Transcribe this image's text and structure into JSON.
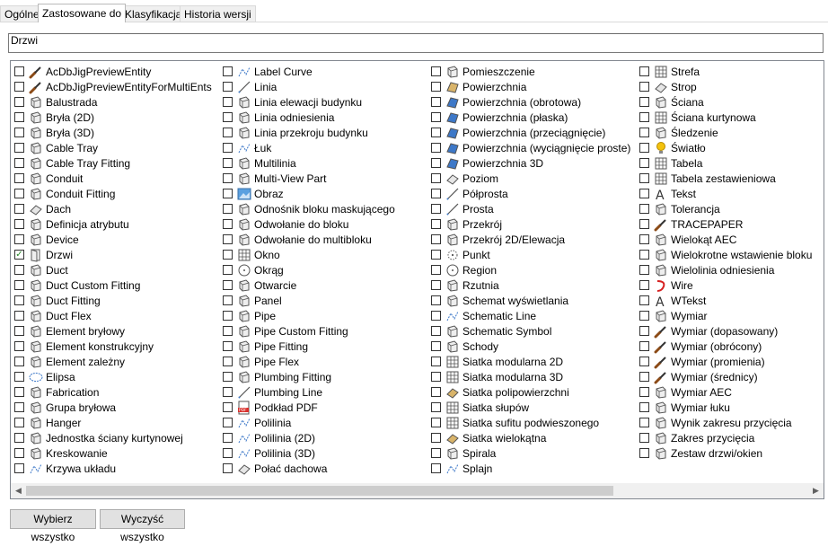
{
  "tabs": [
    "Ogólne",
    "Zastosowane do",
    "Klasyfikacja",
    "Historia wersji"
  ],
  "active_tab": 1,
  "search": {
    "value": "Drzwi"
  },
  "buttons": {
    "select_all": "Wybierz wszystko",
    "clear_all": "Wyczyść wszystko"
  },
  "columns": [
    [
      {
        "label": "AcDbJigPreviewEntity",
        "icon": "brush-icon",
        "checked": false
      },
      {
        "label": "AcDbJigPreviewEntityForMultiEnts",
        "icon": "brush-icon",
        "checked": false
      },
      {
        "label": "Balustrada",
        "icon": "railing-icon",
        "checked": false
      },
      {
        "label": "Bryła (2D)",
        "icon": "mass-2d-icon",
        "checked": false
      },
      {
        "label": "Bryła (3D)",
        "icon": "mass-3d-icon",
        "checked": false
      },
      {
        "label": "Cable Tray",
        "icon": "cable-tray-icon",
        "checked": false
      },
      {
        "label": "Cable Tray Fitting",
        "icon": "cable-tray-fitting-icon",
        "checked": false
      },
      {
        "label": "Conduit",
        "icon": "conduit-icon",
        "checked": false
      },
      {
        "label": "Conduit Fitting",
        "icon": "conduit-fitting-icon",
        "checked": false
      },
      {
        "label": "Dach",
        "icon": "roof-icon",
        "checked": false
      },
      {
        "label": "Definicja atrybutu",
        "icon": "tag-icon",
        "checked": false
      },
      {
        "label": "Device",
        "icon": "device-icon",
        "checked": false
      },
      {
        "label": "Drzwi",
        "icon": "door-icon",
        "checked": true
      },
      {
        "label": "Duct",
        "icon": "duct-icon",
        "checked": false
      },
      {
        "label": "Duct Custom Fitting",
        "icon": "duct-custom-fitting-icon",
        "checked": false
      },
      {
        "label": "Duct Fitting",
        "icon": "duct-fitting-icon",
        "checked": false
      },
      {
        "label": "Duct Flex",
        "icon": "duct-flex-icon",
        "checked": false
      },
      {
        "label": "Element bryłowy",
        "icon": "mass-element-icon",
        "checked": false
      },
      {
        "label": "Element konstrukcyjny",
        "icon": "structural-member-icon",
        "checked": false
      },
      {
        "label": "Element zależny",
        "icon": "dependent-element-icon",
        "checked": false
      },
      {
        "label": "Elipsa",
        "icon": "ellipse-icon",
        "checked": false
      },
      {
        "label": "Fabrication",
        "icon": "fabrication-icon",
        "checked": false
      },
      {
        "label": "Grupa bryłowa",
        "icon": "mass-group-icon",
        "checked": false
      },
      {
        "label": "Hanger",
        "icon": "hanger-icon",
        "checked": false
      },
      {
        "label": "Jednostka ściany kurtynowej",
        "icon": "curtain-wall-unit-icon",
        "checked": false
      },
      {
        "label": "Kreskowanie",
        "icon": "hatch-icon",
        "checked": false
      },
      {
        "label": "Krzywa układu",
        "icon": "layout-curve-icon",
        "checked": false
      }
    ],
    [
      {
        "label": "Label Curve",
        "icon": "label-curve-icon",
        "checked": false
      },
      {
        "label": "Linia",
        "icon": "line-icon",
        "checked": false
      },
      {
        "label": "Linia elewacji budynku",
        "icon": "elevation-line-icon",
        "checked": false
      },
      {
        "label": "Linia odniesienia",
        "icon": "reference-line-icon",
        "checked": false
      },
      {
        "label": "Linia przekroju budynku",
        "icon": "section-line-icon",
        "checked": false
      },
      {
        "label": "Łuk",
        "icon": "arc-icon",
        "checked": false
      },
      {
        "label": "Multilinia",
        "icon": "multiline-icon",
        "checked": false
      },
      {
        "label": "Multi-View Part",
        "icon": "multi-view-part-icon",
        "checked": false
      },
      {
        "label": "Obraz",
        "icon": "image-icon",
        "checked": false
      },
      {
        "label": "Odnośnik bloku maskującego",
        "icon": "mask-block-icon",
        "checked": false
      },
      {
        "label": "Odwołanie do bloku",
        "icon": "block-reference-icon",
        "checked": false
      },
      {
        "label": "Odwołanie do multibloku",
        "icon": "multiblock-reference-icon",
        "checked": false
      },
      {
        "label": "Okno",
        "icon": "window-icon",
        "checked": false
      },
      {
        "label": "Okrąg",
        "icon": "circle-icon",
        "checked": false
      },
      {
        "label": "Otwarcie",
        "icon": "opening-icon",
        "checked": false
      },
      {
        "label": "Panel",
        "icon": "panel-icon",
        "checked": false
      },
      {
        "label": "Pipe",
        "icon": "pipe-icon",
        "checked": false
      },
      {
        "label": "Pipe Custom Fitting",
        "icon": "pipe-custom-fitting-icon",
        "checked": false
      },
      {
        "label": "Pipe Fitting",
        "icon": "pipe-fitting-icon",
        "checked": false
      },
      {
        "label": "Pipe Flex",
        "icon": "pipe-flex-icon",
        "checked": false
      },
      {
        "label": "Plumbing Fitting",
        "icon": "plumbing-fitting-icon",
        "checked": false
      },
      {
        "label": "Plumbing Line",
        "icon": "plumbing-line-icon",
        "checked": false
      },
      {
        "label": "Podkład PDF",
        "icon": "pdf-icon",
        "checked": false
      },
      {
        "label": "Polilinia",
        "icon": "polyline-icon",
        "checked": false
      },
      {
        "label": "Polilinia (2D)",
        "icon": "polyline-2d-icon",
        "checked": false
      },
      {
        "label": "Polilinia (3D)",
        "icon": "polyline-3d-icon",
        "checked": false
      },
      {
        "label": "Połać dachowa",
        "icon": "roof-slab-icon",
        "checked": false
      }
    ],
    [
      {
        "label": "Pomieszczenie",
        "icon": "space-icon",
        "checked": false
      },
      {
        "label": "Powierzchnia",
        "icon": "surface-icon",
        "checked": false
      },
      {
        "label": "Powierzchnia (obrotowa)",
        "icon": "surface-revolve-icon",
        "checked": false
      },
      {
        "label": "Powierzchnia (płaska)",
        "icon": "surface-planar-icon",
        "checked": false
      },
      {
        "label": "Powierzchnia (przeciągnięcie)",
        "icon": "surface-sweep-icon",
        "checked": false
      },
      {
        "label": "Powierzchnia (wyciągnięcie proste)",
        "icon": "surface-extrude-icon",
        "checked": false
      },
      {
        "label": "Powierzchnia 3D",
        "icon": "surface-3d-icon",
        "checked": false
      },
      {
        "label": "Poziom",
        "icon": "level-icon",
        "checked": false
      },
      {
        "label": "Półprosta",
        "icon": "ray-icon",
        "checked": false
      },
      {
        "label": "Prosta",
        "icon": "xline-icon",
        "checked": false
      },
      {
        "label": "Przekrój",
        "icon": "section-icon",
        "checked": false
      },
      {
        "label": "Przekrój 2D/Elewacja",
        "icon": "section-2d-icon",
        "checked": false
      },
      {
        "label": "Punkt",
        "icon": "point-icon",
        "checked": false
      },
      {
        "label": "Region",
        "icon": "region-icon",
        "checked": false
      },
      {
        "label": "Rzutnia",
        "icon": "viewport-icon",
        "checked": false
      },
      {
        "label": "Schemat wyświetlania",
        "icon": "display-theme-icon",
        "checked": false
      },
      {
        "label": "Schematic Line",
        "icon": "schematic-line-icon",
        "checked": false
      },
      {
        "label": "Schematic Symbol",
        "icon": "schematic-symbol-icon",
        "checked": false
      },
      {
        "label": "Schody",
        "icon": "stair-icon",
        "checked": false
      },
      {
        "label": "Siatka modularna 2D",
        "icon": "grid-2d-icon",
        "checked": false
      },
      {
        "label": "Siatka modularna 3D",
        "icon": "grid-3d-icon",
        "checked": false
      },
      {
        "label": "Siatka polipowierzchni",
        "icon": "polyface-mesh-icon",
        "checked": false
      },
      {
        "label": "Siatka słupów",
        "icon": "column-grid-icon",
        "checked": false
      },
      {
        "label": "Siatka sufitu podwieszonego",
        "icon": "ceiling-grid-icon",
        "checked": false
      },
      {
        "label": "Siatka wielokątna",
        "icon": "polygon-mesh-icon",
        "checked": false
      },
      {
        "label": "Spirala",
        "icon": "helix-icon",
        "checked": false
      },
      {
        "label": "Splajn",
        "icon": "spline-icon",
        "checked": false
      }
    ],
    [
      {
        "label": "Strefa",
        "icon": "zone-icon",
        "checked": false
      },
      {
        "label": "Strop",
        "icon": "slab-icon",
        "checked": false
      },
      {
        "label": "Ściana",
        "icon": "wall-icon",
        "checked": false
      },
      {
        "label": "Ściana kurtynowa",
        "icon": "curtain-wall-icon",
        "checked": false
      },
      {
        "label": "Śledzenie",
        "icon": "trace-icon",
        "checked": false
      },
      {
        "label": "Światło",
        "icon": "light-icon",
        "checked": false
      },
      {
        "label": "Tabela",
        "icon": "table-icon",
        "checked": false
      },
      {
        "label": "Tabela zestawieniowa",
        "icon": "schedule-table-icon",
        "checked": false
      },
      {
        "label": "Tekst",
        "icon": "text-icon",
        "checked": false
      },
      {
        "label": "Tolerancja",
        "icon": "tolerance-icon",
        "checked": false
      },
      {
        "label": "TRACEPAPER",
        "icon": "brush-icon",
        "checked": false
      },
      {
        "label": "Wielokąt AEC",
        "icon": "aec-polygon-icon",
        "checked": false
      },
      {
        "label": "Wielokrotne wstawienie bloku",
        "icon": "minsert-icon",
        "checked": false
      },
      {
        "label": "Wielolinia odniesienia",
        "icon": "multileader-icon",
        "checked": false
      },
      {
        "label": "Wire",
        "icon": "wire-icon",
        "checked": false
      },
      {
        "label": "WTekst",
        "icon": "mtext-icon",
        "checked": false
      },
      {
        "label": "Wymiar",
        "icon": "dimension-icon",
        "checked": false
      },
      {
        "label": "Wymiar (dopasowany)",
        "icon": "brush-icon",
        "checked": false
      },
      {
        "label": "Wymiar (obrócony)",
        "icon": "brush-icon",
        "checked": false
      },
      {
        "label": "Wymiar (promienia)",
        "icon": "brush-icon",
        "checked": false
      },
      {
        "label": "Wymiar (średnicy)",
        "icon": "brush-icon",
        "checked": false
      },
      {
        "label": "Wymiar AEC",
        "icon": "aec-dimension-icon",
        "checked": false
      },
      {
        "label": "Wymiar łuku",
        "icon": "arc-dimension-icon",
        "checked": false
      },
      {
        "label": "Wynik zakresu przycięcia",
        "icon": "clip-result-icon",
        "checked": false
      },
      {
        "label": "Zakres przycięcia",
        "icon": "clip-volume-icon",
        "checked": false
      },
      {
        "label": "Zestaw drzwi/okien",
        "icon": "door-window-assembly-icon",
        "checked": false
      }
    ]
  ],
  "colors": {
    "accent": "#2a8a2a",
    "brush_handle": "#8b4a16",
    "icon_gray": "#555555",
    "icon_blue": "#3d78c8",
    "icon_tan": "#d9b46a"
  }
}
